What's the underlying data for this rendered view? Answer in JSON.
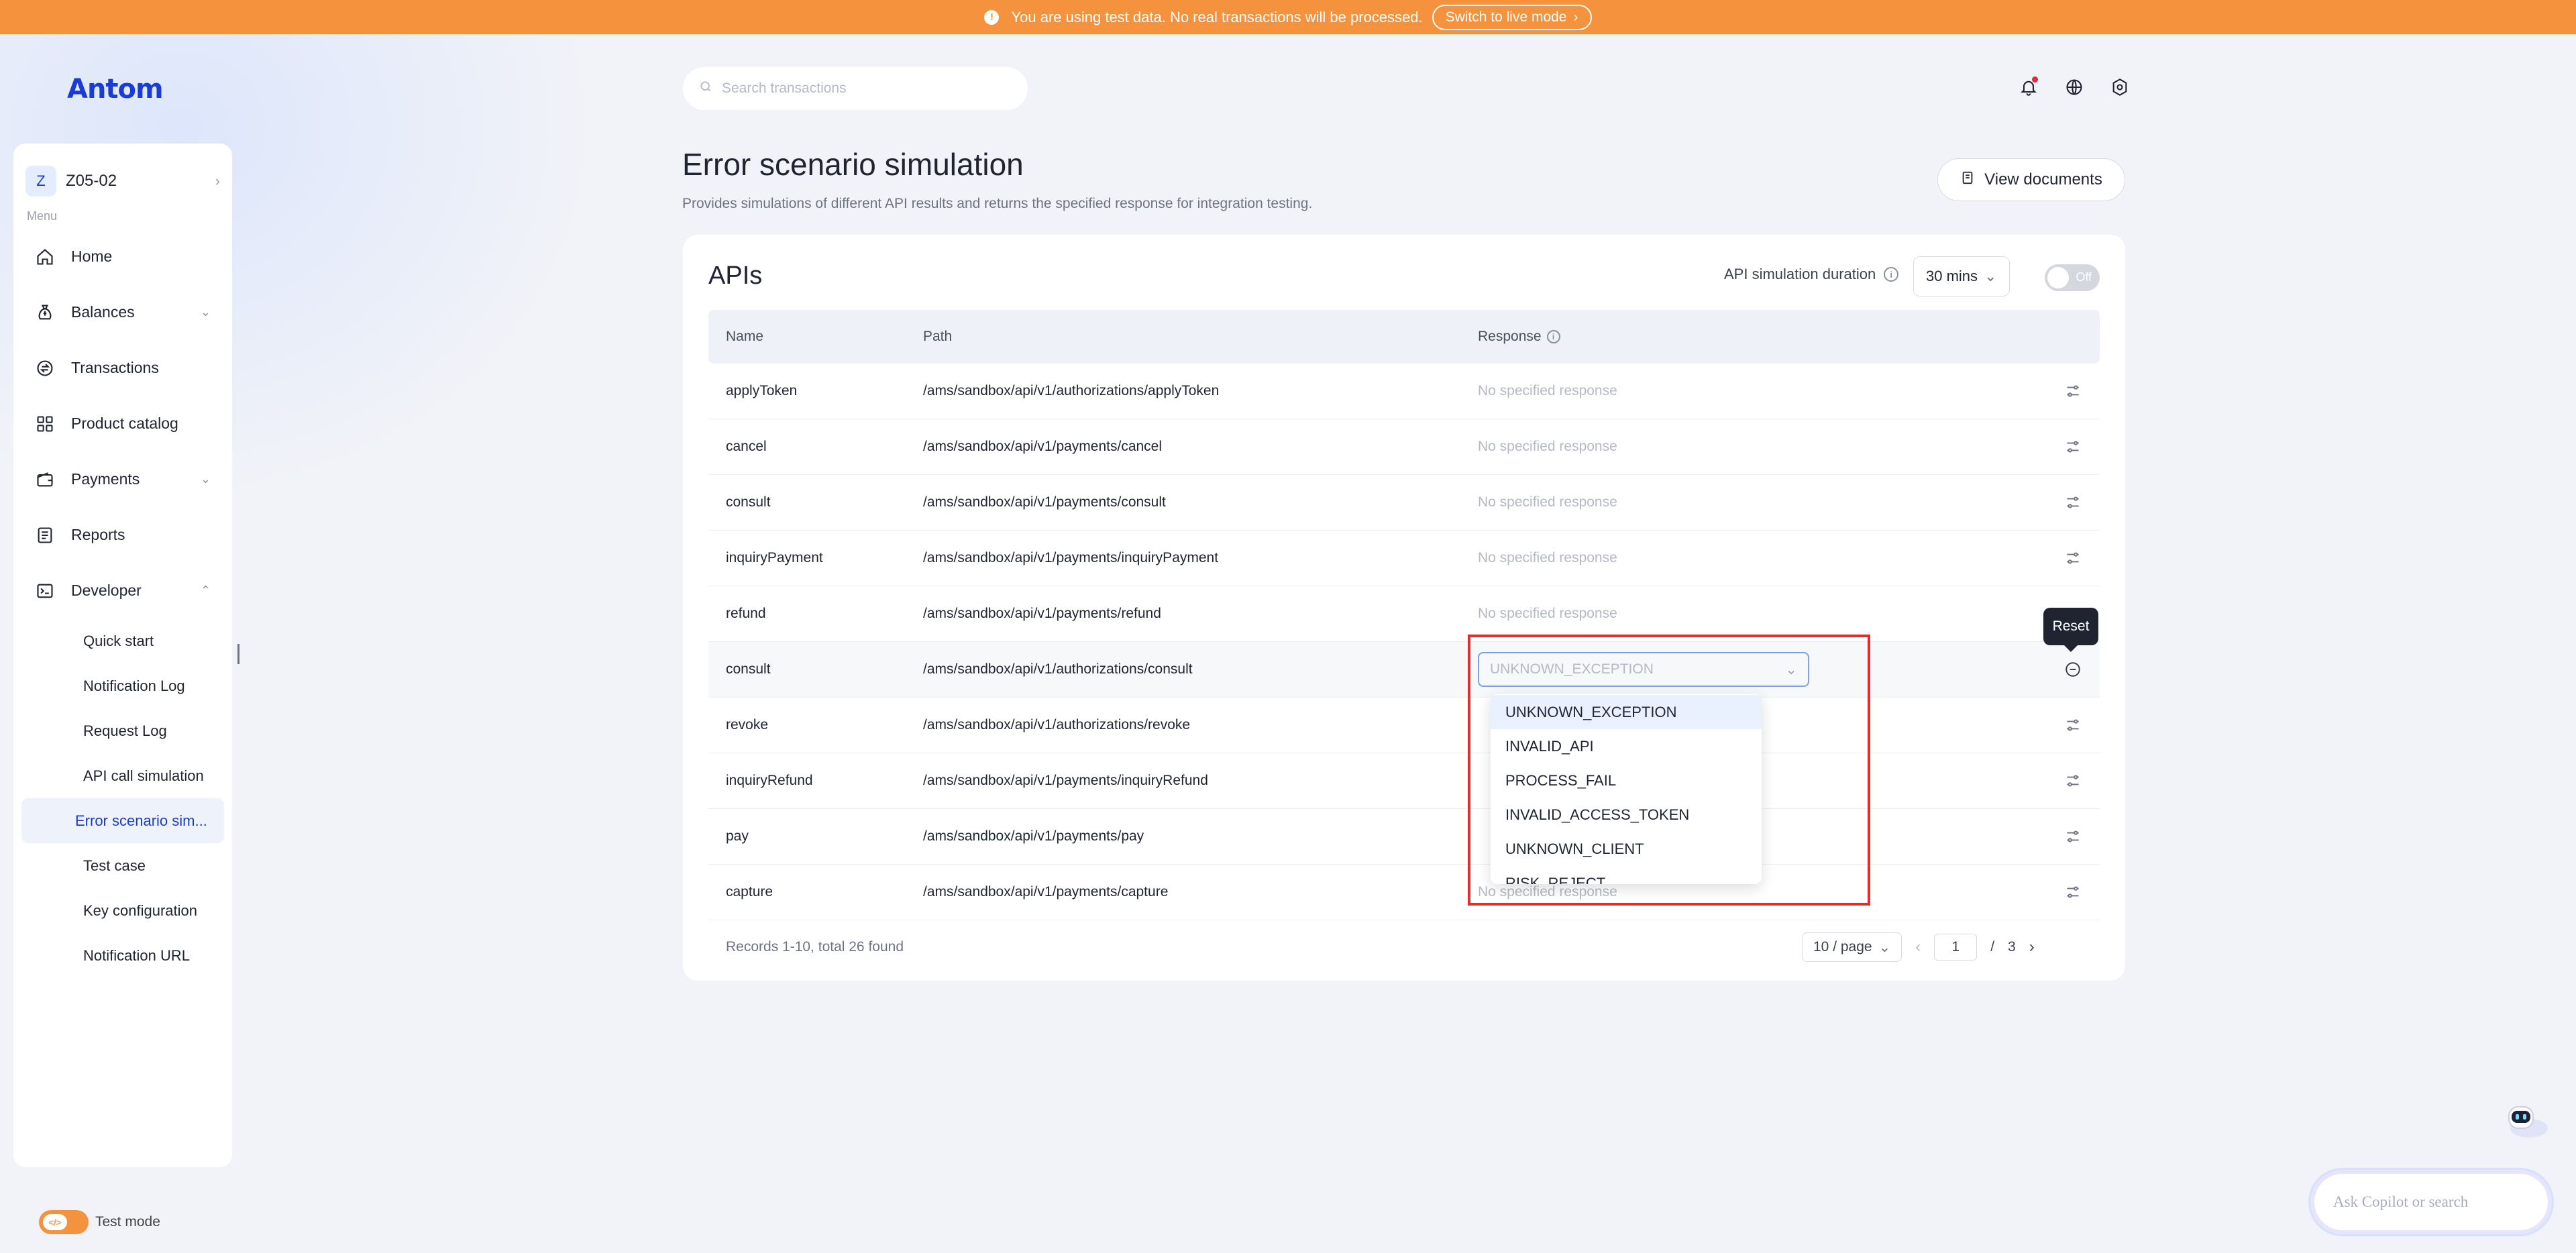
{
  "banner": {
    "message": "You are using test data. No real transactions will be processed.",
    "live_button": "Switch to live mode"
  },
  "brand": {
    "logo": "Antom"
  },
  "account": {
    "initial": "Z",
    "name": "Z05-02"
  },
  "sidebar": {
    "menu_caption": "Menu",
    "items": [
      {
        "label": "Home",
        "icon": "home-icon"
      },
      {
        "label": "Balances",
        "icon": "money-bag-icon",
        "expandable": true
      },
      {
        "label": "Transactions",
        "icon": "transactions-icon"
      },
      {
        "label": "Product catalog",
        "icon": "grid-icon"
      },
      {
        "label": "Payments",
        "icon": "wallet-icon",
        "expandable": true
      },
      {
        "label": "Reports",
        "icon": "report-icon"
      },
      {
        "label": "Developer",
        "icon": "terminal-icon",
        "expanded": true
      }
    ],
    "developer_sub": [
      "Quick start",
      "Notification Log",
      "Request Log",
      "API call simulation",
      "Error scenario sim...",
      "Test case",
      "Key configuration",
      "Notification URL"
    ],
    "active_sub_index": 4,
    "test_mode_label": "Test mode"
  },
  "search": {
    "placeholder": "Search transactions"
  },
  "page": {
    "title": "Error scenario simulation",
    "subtitle": "Provides simulations of different API results and returns the specified response for integration testing.",
    "view_docs": "View documents"
  },
  "card": {
    "title": "APIs",
    "sim_duration_label": "API simulation duration",
    "duration_value": "30 mins",
    "toggle_label": "Off",
    "columns": {
      "name": "Name",
      "path": "Path",
      "response": "Response"
    },
    "rows": [
      {
        "name": "applyToken",
        "path": "/ams/sandbox/api/v1/authorizations/applyToken",
        "response": "No specified response"
      },
      {
        "name": "cancel",
        "path": "/ams/sandbox/api/v1/payments/cancel",
        "response": "No specified response"
      },
      {
        "name": "consult",
        "path": "/ams/sandbox/api/v1/payments/consult",
        "response": "No specified response"
      },
      {
        "name": "inquiryPayment",
        "path": "/ams/sandbox/api/v1/payments/inquiryPayment",
        "response": "No specified response"
      },
      {
        "name": "refund",
        "path": "/ams/sandbox/api/v1/payments/refund",
        "response": "No specified response"
      },
      {
        "name": "consult",
        "path": "/ams/sandbox/api/v1/authorizations/consult",
        "response": "UNKNOWN_EXCEPTION"
      },
      {
        "name": "revoke",
        "path": "/ams/sandbox/api/v1/authorizations/revoke",
        "response": ""
      },
      {
        "name": "inquiryRefund",
        "path": "/ams/sandbox/api/v1/payments/inquiryRefund",
        "response": ""
      },
      {
        "name": "pay",
        "path": "/ams/sandbox/api/v1/payments/pay",
        "response": ""
      },
      {
        "name": "capture",
        "path": "/ams/sandbox/api/v1/payments/capture",
        "response": "No specified response"
      }
    ],
    "records_text": "Records 1-10, total 26 found",
    "page_size": "10 / page",
    "current_page": "1",
    "page_sep": "/",
    "total_pages": "3"
  },
  "dropdown": {
    "options": [
      "UNKNOWN_EXCEPTION",
      "INVALID_API",
      "PROCESS_FAIL",
      "INVALID_ACCESS_TOKEN",
      "UNKNOWN_CLIENT",
      "RISK_REJECT"
    ],
    "selected_index": 0
  },
  "tooltip": {
    "text": "Reset"
  },
  "copilot": {
    "placeholder": "Ask Copilot or search"
  },
  "colors": {
    "banner": "#f5923d",
    "brand": "#1a3bd6",
    "highlight": "#e22d2d"
  }
}
